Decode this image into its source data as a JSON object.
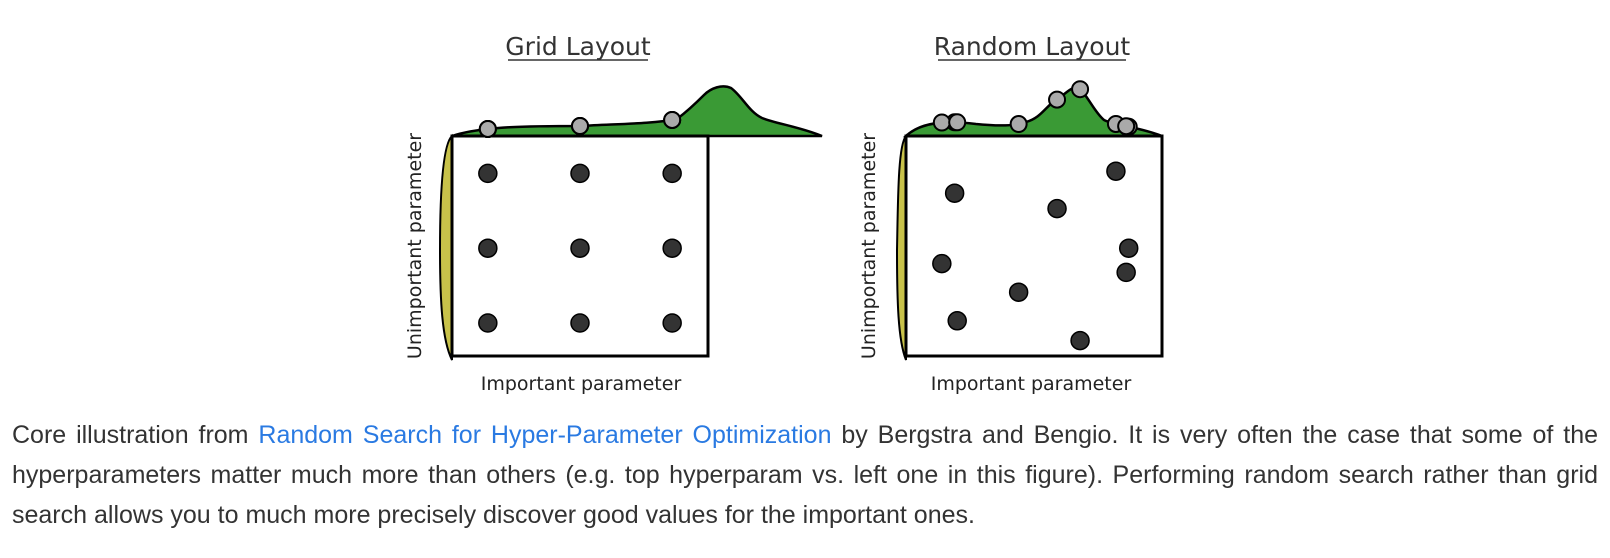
{
  "figure": {
    "panels": [
      {
        "id": "grid",
        "title": "Grid Layout",
        "xlabel": "Important parameter",
        "ylabel": "Unimportant parameter",
        "points": [
          [
            0.14,
            0.83
          ],
          [
            0.5,
            0.83
          ],
          [
            0.86,
            0.83
          ],
          [
            0.14,
            0.49
          ],
          [
            0.5,
            0.49
          ],
          [
            0.86,
            0.49
          ],
          [
            0.14,
            0.15
          ],
          [
            0.5,
            0.15
          ],
          [
            0.86,
            0.15
          ]
        ]
      },
      {
        "id": "random",
        "title": "Random Layout",
        "xlabel": "Important parameter",
        "ylabel": "Unimportant parameter",
        "points": [
          [
            0.19,
            0.74
          ],
          [
            0.59,
            0.67
          ],
          [
            0.82,
            0.84
          ],
          [
            0.14,
            0.42
          ],
          [
            0.44,
            0.29
          ],
          [
            0.87,
            0.49
          ],
          [
            0.86,
            0.38
          ],
          [
            0.2,
            0.16
          ],
          [
            0.68,
            0.07
          ]
        ]
      }
    ],
    "colors": {
      "top_density": "#3a9a35",
      "left_density": "#c8c24a",
      "point": "#333333",
      "projected_point": "#aaaaaa"
    }
  },
  "caption": {
    "prefix": "Core illustration from ",
    "link_text": "Random Search for Hyper-Parameter Optimization",
    "suffix": " by Bergstra and Bengio. It is very often the case that some of the hyperparameters matter much more than others (e.g. top hyperparam vs. left one in this figure). Performing random search rather than grid search allows you to much more precisely discover good values for the important ones."
  }
}
